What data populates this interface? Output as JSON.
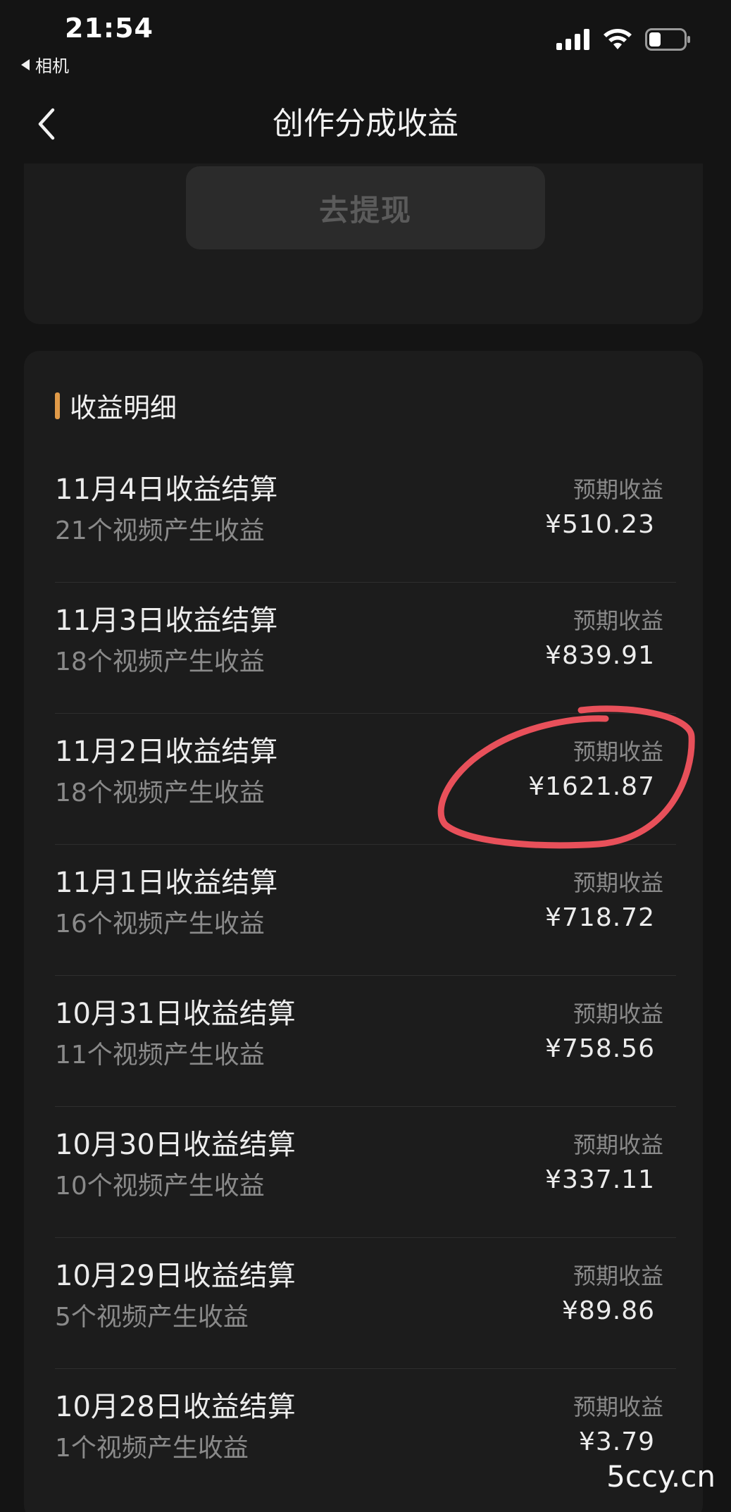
{
  "status_bar": {
    "time": "21:54",
    "back_app": "相机"
  },
  "nav": {
    "title": "创作分成收益"
  },
  "withdraw": {
    "label": "去提现"
  },
  "details": {
    "section_title": "收益明细",
    "rows": [
      {
        "title": "11月4日收益结算",
        "sub": "21个视频产生收益",
        "label": "预期收益",
        "amount": "¥510.23"
      },
      {
        "title": "11月3日收益结算",
        "sub": "18个视频产生收益",
        "label": "预期收益",
        "amount": "¥839.91"
      },
      {
        "title": "11月2日收益结算",
        "sub": "18个视频产生收益",
        "label": "预期收益",
        "amount": "¥1621.87"
      },
      {
        "title": "11月1日收益结算",
        "sub": "16个视频产生收益",
        "label": "预期收益",
        "amount": "¥718.72"
      },
      {
        "title": "10月31日收益结算",
        "sub": "11个视频产生收益",
        "label": "预期收益",
        "amount": "¥758.56"
      },
      {
        "title": "10月30日收益结算",
        "sub": "10个视频产生收益",
        "label": "预期收益",
        "amount": "¥337.11"
      },
      {
        "title": "10月29日收益结算",
        "sub": "5个视频产生收益",
        "label": "预期收益",
        "amount": "¥89.86"
      },
      {
        "title": "10月28日收益结算",
        "sub": "1个视频产生收益",
        "label": "预期收益",
        "amount": "¥3.79"
      }
    ]
  },
  "watermark": "5ccy.cn",
  "colors": {
    "background": "#141414",
    "card": "#1c1c1c",
    "accent": "#e09a48",
    "annotation": "#e8505a"
  }
}
